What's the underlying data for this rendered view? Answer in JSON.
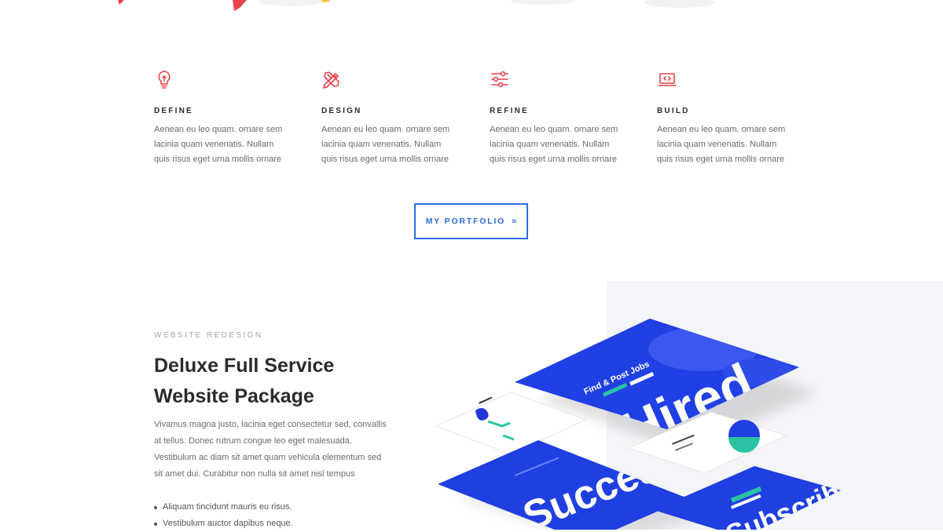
{
  "features": [
    {
      "icon": "lightbulb-icon",
      "title": "DEFINE",
      "text": "Aenean eu leo quam. ornare sem lacinia quam venenatis. Nullam quis risus eget urna mollis ornare"
    },
    {
      "icon": "pencil-ruler-icon",
      "title": "DESIGN",
      "text": "Aenean eu leo quam. ornare sem lacinia quam venenatis. Nullam quis risus eget urna mollis ornare"
    },
    {
      "icon": "sliders-icon",
      "title": "REFINE",
      "text": "Aenean eu leo quam. ornare sem lacinia quam venenatis. Nullam quis risus eget urna mollis ornare"
    },
    {
      "icon": "code-laptop-icon",
      "title": "BUILD",
      "text": "Aenean eu leo quam. ornare sem lacinia quam venenatis. Nullam quis risus eget urna mollis ornare"
    }
  ],
  "portfolio": {
    "label": "MY PORTFOLIO",
    "arrow": "»"
  },
  "project": {
    "eyebrow": "WEBSITE REDESIGN",
    "headline": "Deluxe Full Service Website Package",
    "body": "Vivamus magna justo, lacinia eget consectetur sed, convallis at tellus. Donec rutrum congue leo eget malesuada. Vestibulum ac diam sit amet quam vehicula elementum sed sit amet dui. Curabitur non nulla sit amet nisl tempus",
    "bullets": [
      "Aliquam tincidunt mauris eu risus.",
      "Vestibulum auctor dapibus neque."
    ]
  },
  "mockup_text": {
    "hired": "Hired",
    "find_jobs": "Find & Post Jobs",
    "success": "Success",
    "subscribe": "Subscribe"
  },
  "colors": {
    "accent": "#e8434f",
    "button_blue": "#2d6be4",
    "mockup_blue": "#1f3fe0",
    "panel_gray": "#f4f5f8"
  }
}
